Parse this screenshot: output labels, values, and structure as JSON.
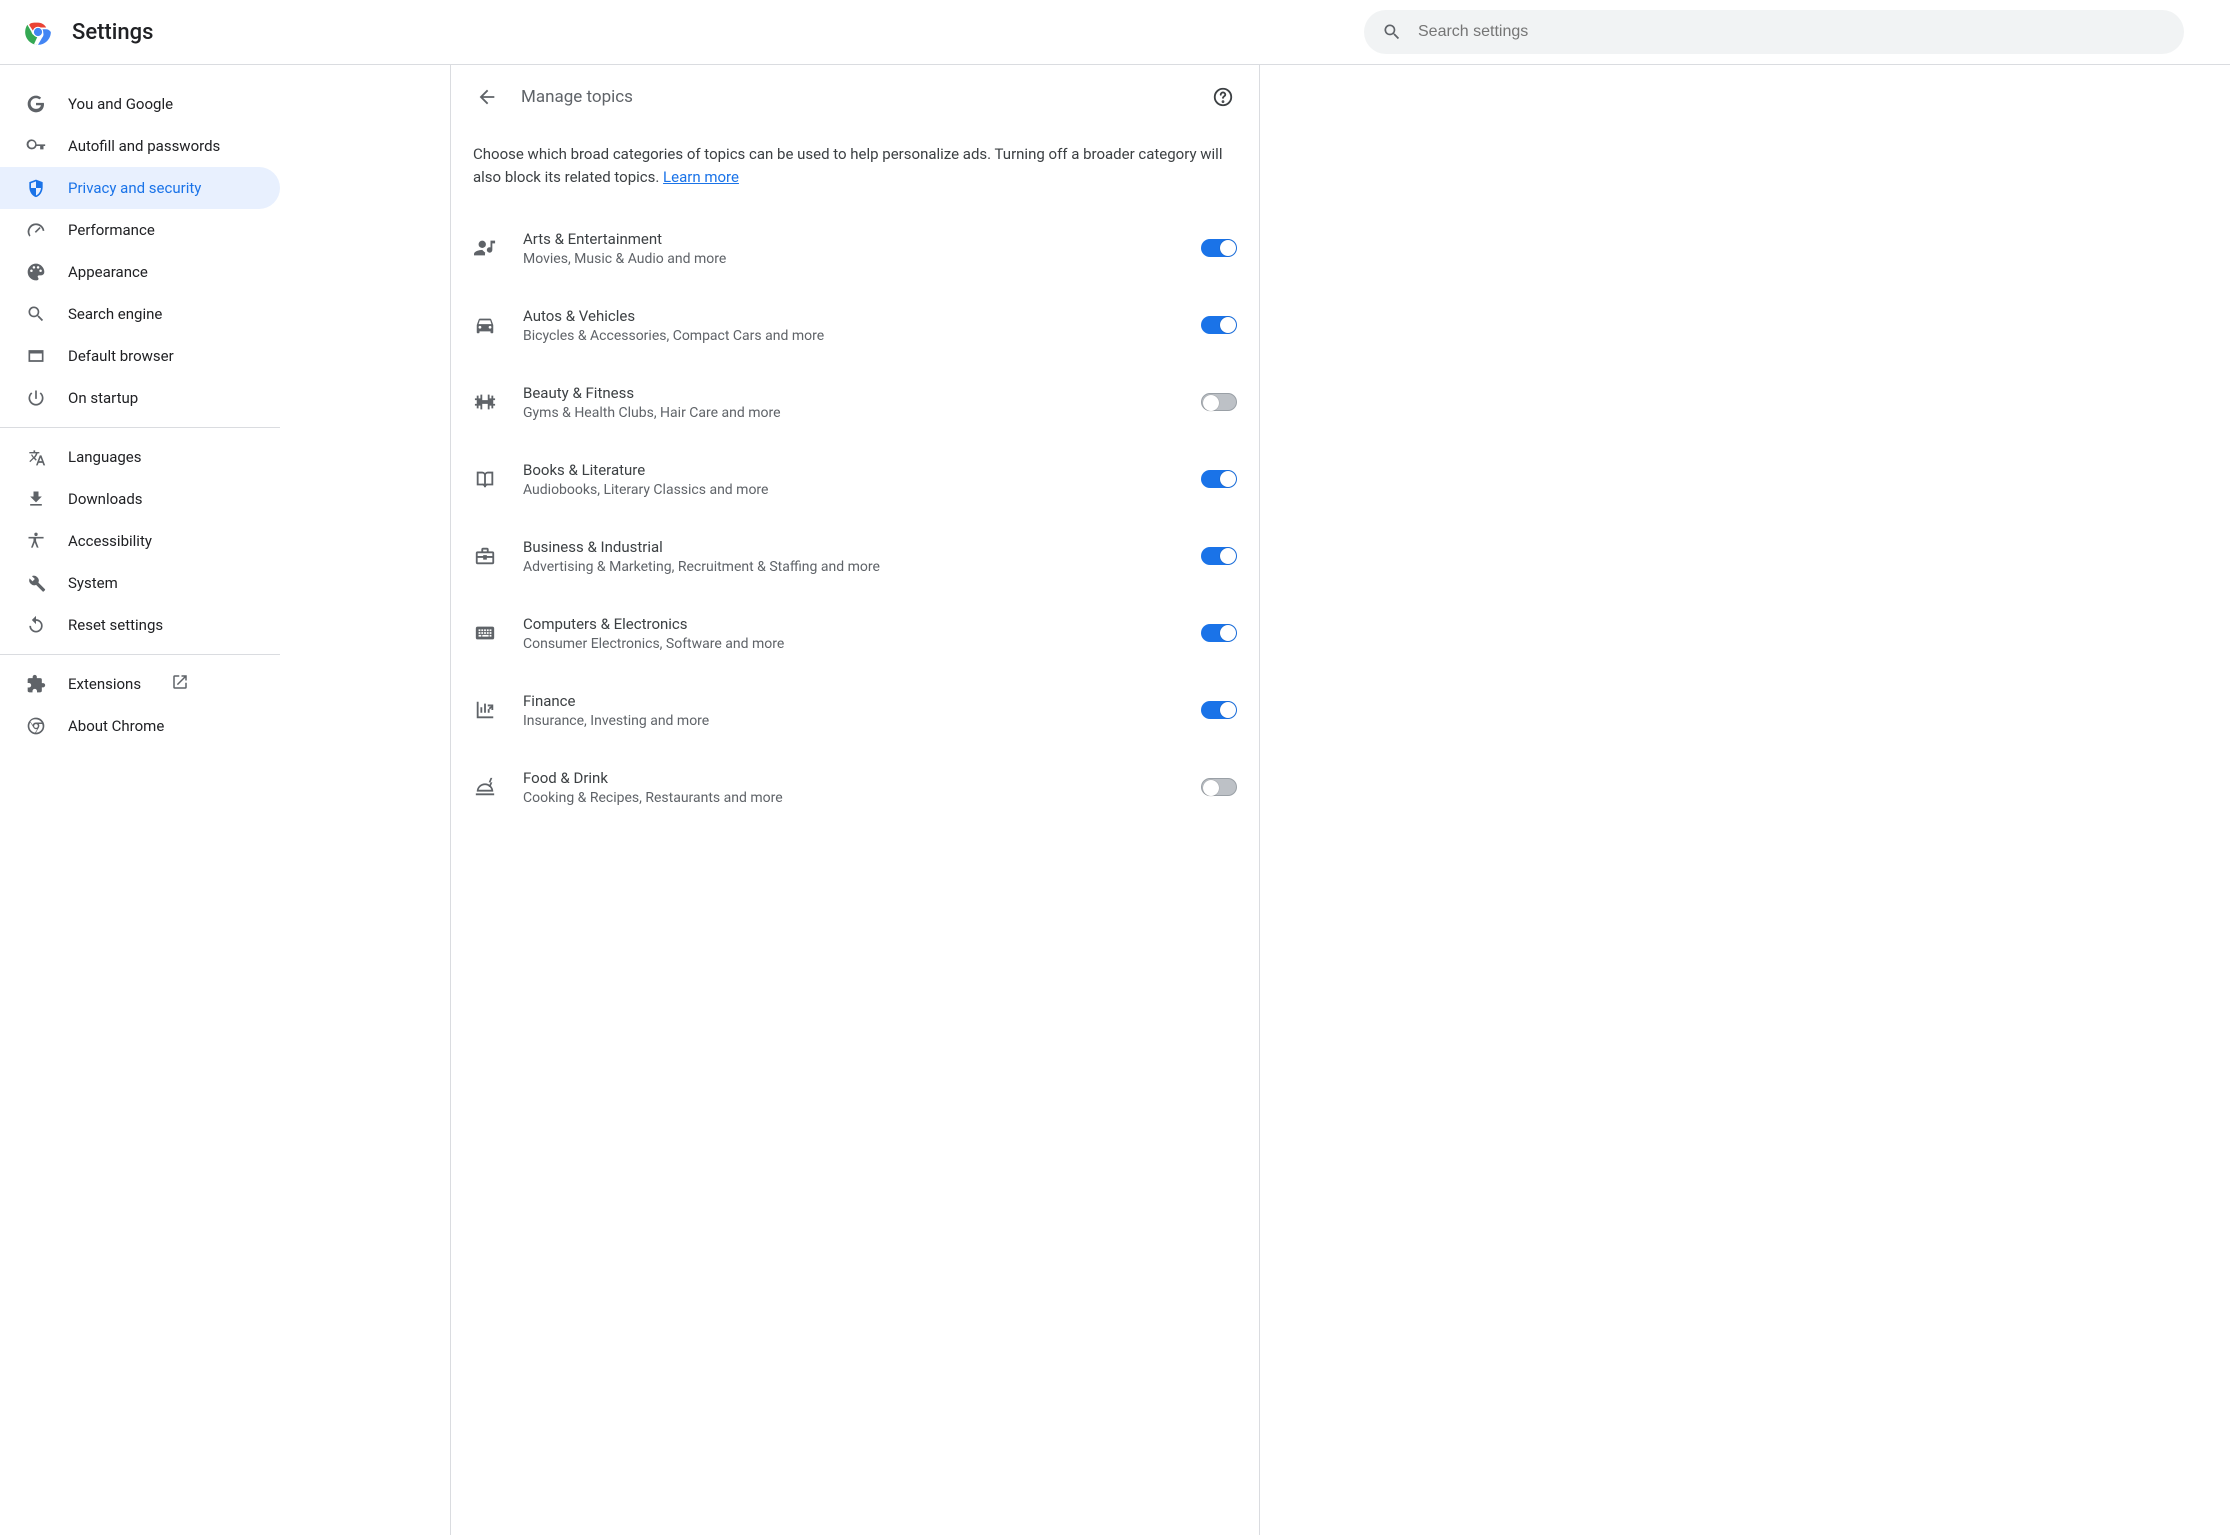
{
  "header": {
    "app_title": "Settings",
    "search_placeholder": "Search settings"
  },
  "sidebar": {
    "items": [
      {
        "label": "You and Google"
      },
      {
        "label": "Autofill and passwords"
      },
      {
        "label": "Privacy and security"
      },
      {
        "label": "Performance"
      },
      {
        "label": "Appearance"
      },
      {
        "label": "Search engine"
      },
      {
        "label": "Default browser"
      },
      {
        "label": "On startup"
      }
    ],
    "section2": [
      {
        "label": "Languages"
      },
      {
        "label": "Downloads"
      },
      {
        "label": "Accessibility"
      },
      {
        "label": "System"
      },
      {
        "label": "Reset settings"
      }
    ],
    "section3": [
      {
        "label": "Extensions"
      },
      {
        "label": "About Chrome"
      }
    ]
  },
  "page": {
    "title": "Manage topics",
    "intro_text": "Choose which broad categories of topics can be used to help personalize ads. Turning off a broader category will also block its related topics. ",
    "learn_more": "Learn more"
  },
  "topics": [
    {
      "title": "Arts & Entertainment",
      "sub": "Movies, Music & Audio and more",
      "on": true
    },
    {
      "title": "Autos & Vehicles",
      "sub": "Bicycles & Accessories, Compact Cars and more",
      "on": true
    },
    {
      "title": "Beauty & Fitness",
      "sub": "Gyms & Health Clubs, Hair Care and more",
      "on": false
    },
    {
      "title": "Books & Literature",
      "sub": "Audiobooks, Literary Classics and more",
      "on": true
    },
    {
      "title": "Business & Industrial",
      "sub": "Advertising & Marketing, Recruitment & Staffing and more",
      "on": true
    },
    {
      "title": "Computers & Electronics",
      "sub": "Consumer Electronics, Software and more",
      "on": true
    },
    {
      "title": "Finance",
      "sub": "Insurance, Investing and more",
      "on": true
    },
    {
      "title": "Food & Drink",
      "sub": "Cooking & Recipes, Restaurants and more",
      "on": false
    }
  ]
}
